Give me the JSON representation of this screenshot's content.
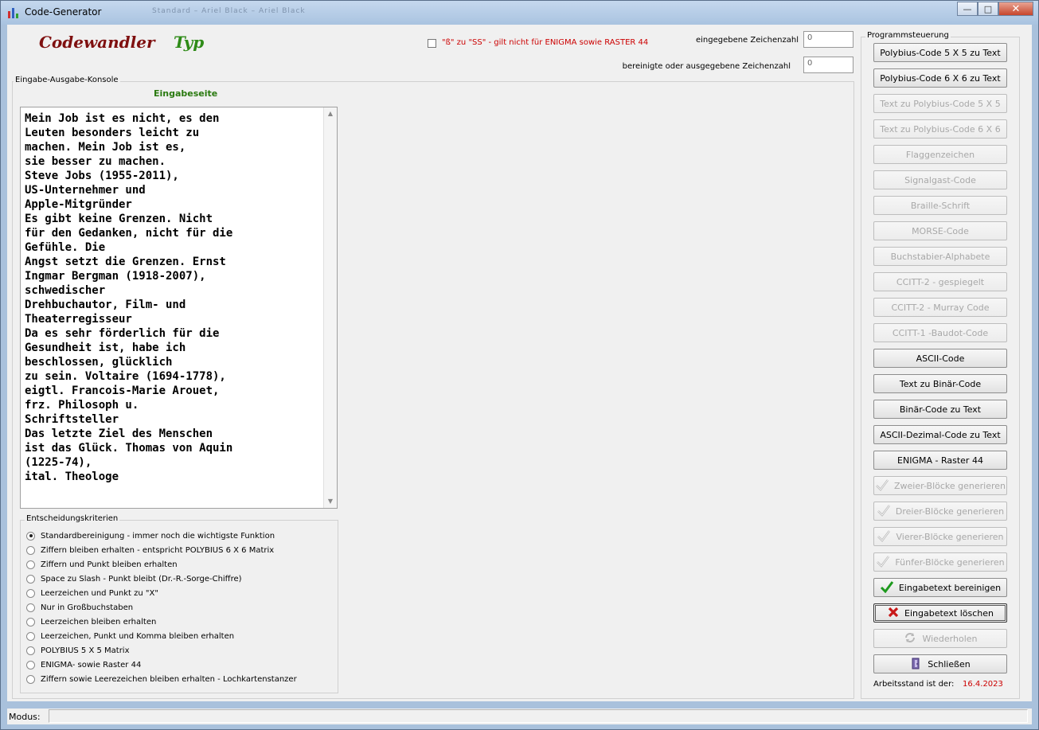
{
  "window": {
    "title": "Code-Generator",
    "ghost_title": "Standard – Ariel Black – Ariel Black"
  },
  "header": {
    "brand_left": "Codewandler",
    "brand_right": "Typ",
    "checkbox_label": "\"ß\" zu \"SS\" - gilt nicht für ENIGMA sowie RASTER 44",
    "checkbox_checked": false,
    "input_count_label": "eingegebene Zeichenzahl",
    "input_count_value": "0",
    "output_count_label": "bereinigte oder ausgegebene Zeichenzahl",
    "output_count_value": "0"
  },
  "console": {
    "group_title": "Eingabe-Ausgabe-Konsole",
    "page_title": "Eingabeseite",
    "text": "Mein Job ist es nicht, es den\nLeuten besonders leicht zu\nmachen. Mein Job ist es,\nsie besser zu machen.\nSteve Jobs (1955-2011),\nUS-Unternehmer und\nApple-Mitgründer\nEs gibt keine Grenzen. Nicht\nfür den Gedanken, nicht für die\nGefühle. Die\nAngst setzt die Grenzen. Ernst\nIngmar Bergman (1918-2007),\nschwedischer\nDrehbuchautor, Film- und\nTheaterregisseur\nDa es sehr förderlich für die\nGesundheit ist, habe ich\nbeschlossen, glücklich\nzu sein. Voltaire (1694-1778),\neigtl. Francois-Marie Arouet,\nfrz. Philosoph u.\nSchriftsteller\nDas letzte Ziel des Menschen\nist das Glück. Thomas von Aquin\n(1225-74),\nital. Theologe"
  },
  "criteria": {
    "group_title": "Entscheidungskriterien",
    "options": [
      {
        "label": "Standardbereinigung - immer noch die wichtigste Funktion",
        "selected": true
      },
      {
        "label": "Ziffern bleiben erhalten - entspricht POLYBIUS 6 X 6 Matrix",
        "selected": false
      },
      {
        "label": "Ziffern und Punkt bleiben erhalten",
        "selected": false
      },
      {
        "label": "Space zu Slash - Punkt bleibt  (Dr.-R.-Sorge-Chiffre)",
        "selected": false
      },
      {
        "label": "Leerzeichen und Punkt zu \"X\"",
        "selected": false
      },
      {
        "label": "Nur in Großbuchstaben",
        "selected": false
      },
      {
        "label": "Leerzeichen bleiben erhalten",
        "selected": false
      },
      {
        "label": "Leerzeichen, Punkt und Komma bleiben erhalten",
        "selected": false
      },
      {
        "label": "POLYBIUS 5 X 5 Matrix",
        "selected": false
      },
      {
        "label": "ENIGMA- sowie Raster 44",
        "selected": false
      },
      {
        "label": "Ziffern sowie Leerezeichen bleiben erhalten - Lochkartenstanzer",
        "selected": false
      }
    ]
  },
  "program": {
    "group_title": "Programmsteuerung",
    "buttons": [
      {
        "label": "Polybius-Code 5 X 5  zu Text",
        "enabled": true,
        "icon": ""
      },
      {
        "label": "Polybius-Code 6 X 6  zu Text",
        "enabled": true,
        "icon": ""
      },
      {
        "label": "Text zu Polybius-Code 5 X 5",
        "enabled": false,
        "icon": ""
      },
      {
        "label": "Text zu Polybius-Code 6  X 6",
        "enabled": false,
        "icon": ""
      },
      {
        "label": "Flaggenzeichen",
        "enabled": false,
        "icon": ""
      },
      {
        "label": "Signalgast-Code",
        "enabled": false,
        "icon": ""
      },
      {
        "label": "Braille-Schrift",
        "enabled": false,
        "icon": ""
      },
      {
        "label": "MORSE-Code",
        "enabled": false,
        "icon": ""
      },
      {
        "label": "Buchstabier-Alphabete",
        "enabled": false,
        "icon": ""
      },
      {
        "label": "CCITT-2 - gespiegelt",
        "enabled": false,
        "icon": ""
      },
      {
        "label": "CCITT-2 - Murray Code",
        "enabled": false,
        "icon": ""
      },
      {
        "label": "CCITT-1  -Baudot-Code",
        "enabled": false,
        "icon": ""
      },
      {
        "label": "ASCII-Code",
        "enabled": true,
        "icon": ""
      },
      {
        "label": "Text zu Binär-Code",
        "enabled": true,
        "icon": ""
      },
      {
        "label": "Binär-Code zu Text",
        "enabled": true,
        "icon": ""
      },
      {
        "label": "ASCII-Dezimal-Code zu Text",
        "enabled": true,
        "icon": ""
      },
      {
        "label": "ENIGMA - Raster 44",
        "enabled": true,
        "icon": ""
      },
      {
        "label": "Zweier-Blöcke generieren",
        "enabled": false,
        "icon": "check-outline-icon"
      },
      {
        "label": "Dreier-Blöcke generieren",
        "enabled": false,
        "icon": "check-outline-icon"
      },
      {
        "label": "Vierer-Blöcke generieren",
        "enabled": false,
        "icon": "check-outline-icon"
      },
      {
        "label": "Fünfer-Blöcke generieren",
        "enabled": false,
        "icon": "check-outline-icon"
      },
      {
        "label": "Eingabetext bereinigen",
        "enabled": true,
        "icon": "green-check-icon"
      },
      {
        "label": "Eingabetext löschen",
        "enabled": true,
        "icon": "red-x-icon",
        "focused": true
      },
      {
        "label": "Wiederholen",
        "enabled": false,
        "icon": "refresh-icon"
      },
      {
        "label": "Schließen",
        "enabled": true,
        "icon": "exit-door-icon"
      }
    ],
    "status_label": "Arbeitsstand ist der:",
    "status_date": "16.4.2023"
  },
  "statusbar": {
    "label": "Modus:"
  },
  "colors": {
    "brand_left": "#7f1010",
    "brand_right": "#2e8b17",
    "warning_red": "#cc0000",
    "page_title_green": "#2a7a10"
  }
}
